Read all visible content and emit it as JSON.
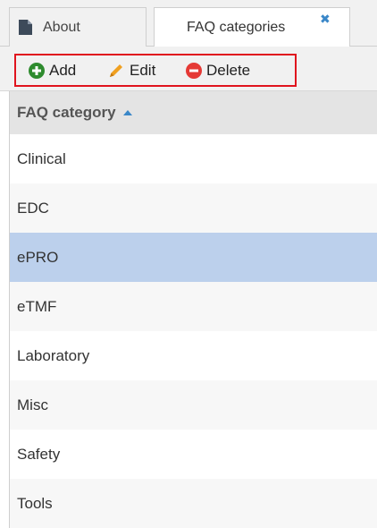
{
  "tabs": [
    {
      "label": "About",
      "icon": "document-icon",
      "active": false
    },
    {
      "label": "FAQ categories",
      "close_icon": "close-icon",
      "active": true
    }
  ],
  "toolbar": {
    "add_label": "Add",
    "edit_label": "Edit",
    "delete_label": "Delete",
    "highlight_color": "#e0141e"
  },
  "grid": {
    "column_header": "FAQ category",
    "sort": "ascending",
    "rows": [
      "Clinical",
      "EDC",
      "ePRO",
      "eTMF",
      "Laboratory",
      "Misc",
      "Safety",
      "Tools"
    ],
    "selected_row": "ePRO",
    "selected_color": "#bcd0ec"
  },
  "colors": {
    "add_green": "#2e8b2e",
    "edit_orange": "#f0a020",
    "delete_red": "#e53935",
    "accent_blue": "#3a87c8"
  }
}
